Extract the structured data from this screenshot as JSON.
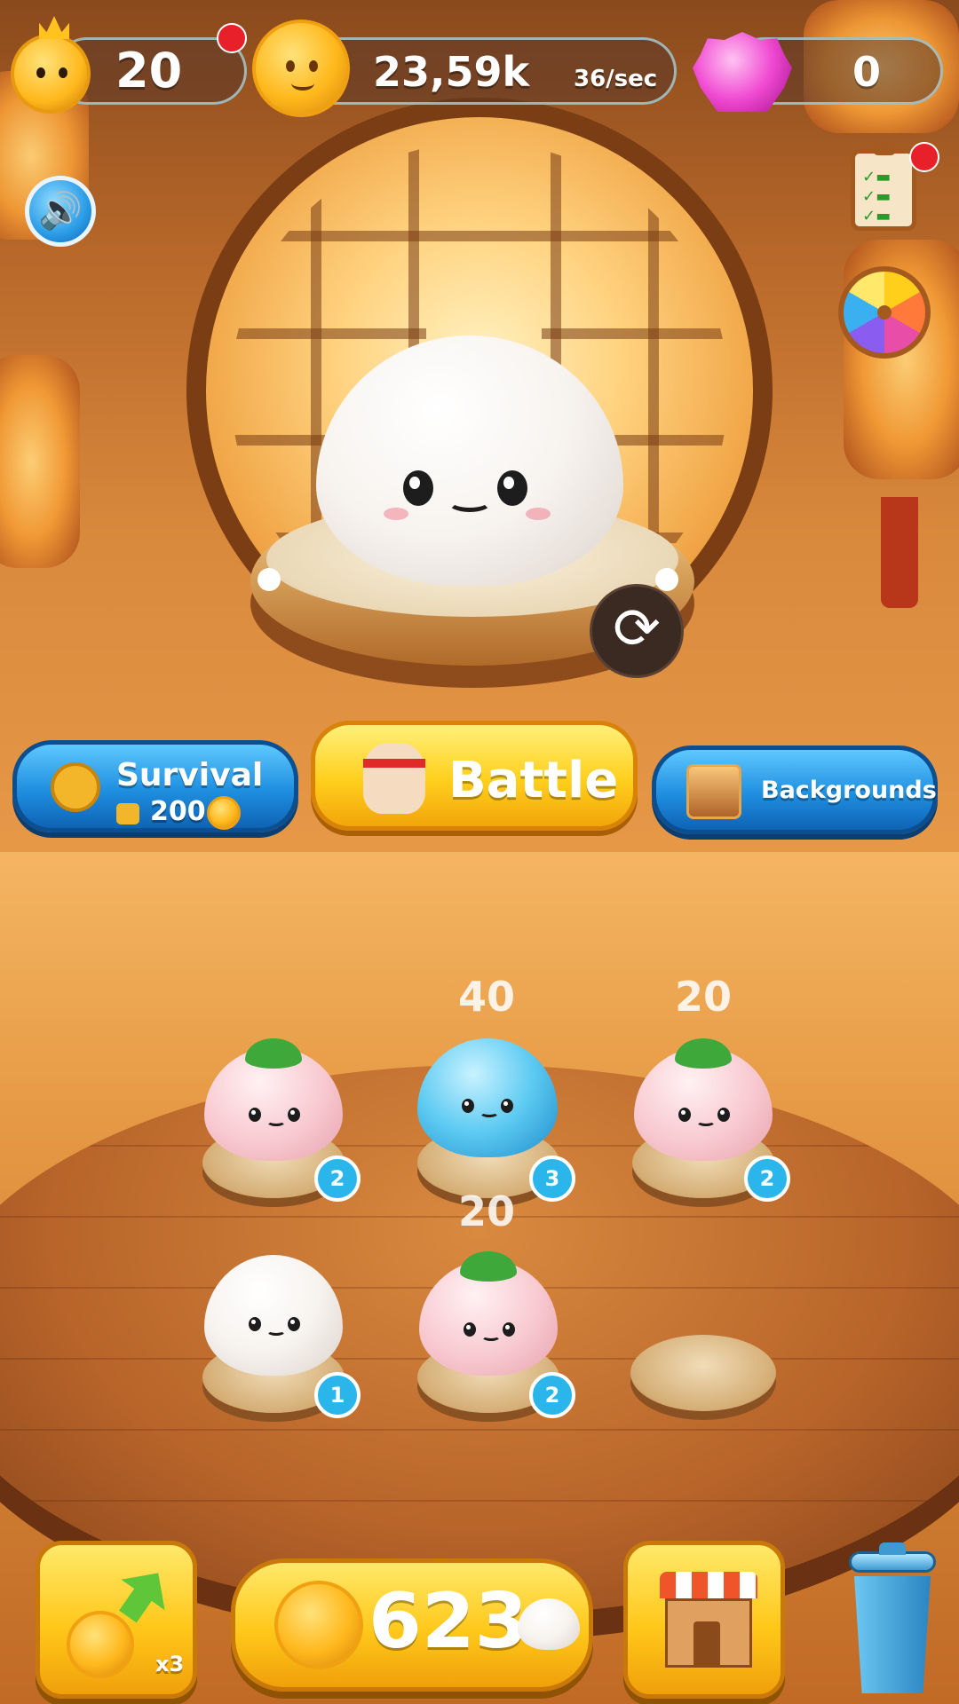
{
  "top_bar": {
    "level": "20",
    "coins": "23,59k",
    "coins_rate": "36/sec",
    "gems": "0"
  },
  "modes": {
    "survival_label": "Survival",
    "survival_cost": "200",
    "battle_label": "Battle",
    "backgrounds_label": "Backgrounds"
  },
  "slots": [
    {
      "value": "",
      "level": "2",
      "kind": "pink"
    },
    {
      "value": "40",
      "level": "3",
      "kind": "blue"
    },
    {
      "value": "20",
      "level": "2",
      "kind": "pink"
    },
    {
      "value": "",
      "level": "1",
      "kind": "white"
    },
    {
      "value": "20",
      "level": "2",
      "kind": "pink"
    },
    {
      "value": "",
      "level": "",
      "kind": "empty"
    }
  ],
  "bottom_bar": {
    "multiplier": "x3",
    "bun_price": "623"
  },
  "icons": {
    "sound": "speaker-icon",
    "tasks": "clipboard-icon",
    "wheel": "fortune-wheel-icon",
    "rotate": "rotate-icon",
    "shop": "shop-icon",
    "trash": "trash-icon"
  },
  "colors": {
    "accent_blue": "#1f8fe0",
    "accent_yellow": "#ffcf1c",
    "badge": "#2ab6ea",
    "notification": "#e8202a"
  }
}
